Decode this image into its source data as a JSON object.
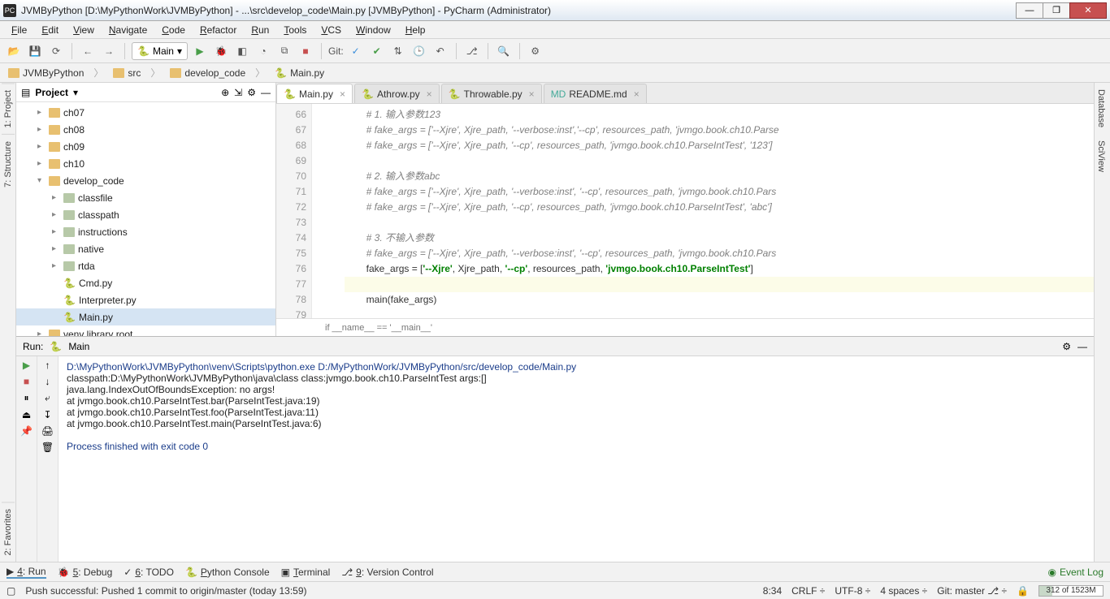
{
  "title": "JVMByPython [D:\\MyPythonWork\\JVMByPython] - ...\\src\\develop_code\\Main.py [JVMByPython] - PyCharm (Administrator)",
  "menu": [
    "File",
    "Edit",
    "View",
    "Navigate",
    "Code",
    "Refactor",
    "Run",
    "Tools",
    "VCS",
    "Window",
    "Help"
  ],
  "runConfig": "Main",
  "gitLabel": "Git:",
  "breadcrumbs": [
    "JVMByPython",
    "src",
    "develop_code",
    "Main.py"
  ],
  "leftTabs": [
    "1: Project",
    "7: Structure"
  ],
  "rightTabs": [
    "Database",
    "SciView"
  ],
  "bottomLeftTab": "2: Favorites",
  "project": {
    "header": "Project",
    "nodes": [
      {
        "indent": 1,
        "arrow": "▸",
        "type": "folder",
        "label": "ch07"
      },
      {
        "indent": 1,
        "arrow": "▸",
        "type": "folder",
        "label": "ch08"
      },
      {
        "indent": 1,
        "arrow": "▸",
        "type": "folder",
        "label": "ch09"
      },
      {
        "indent": 1,
        "arrow": "▸",
        "type": "folder",
        "label": "ch10"
      },
      {
        "indent": 1,
        "arrow": "▾",
        "type": "folder",
        "label": "develop_code"
      },
      {
        "indent": 2,
        "arrow": "▸",
        "type": "dir",
        "label": "classfile"
      },
      {
        "indent": 2,
        "arrow": "▸",
        "type": "dir",
        "label": "classpath"
      },
      {
        "indent": 2,
        "arrow": "▸",
        "type": "dir",
        "label": "instructions"
      },
      {
        "indent": 2,
        "arrow": "▸",
        "type": "dir",
        "label": "native"
      },
      {
        "indent": 2,
        "arrow": "▸",
        "type": "dir",
        "label": "rtda"
      },
      {
        "indent": 2,
        "arrow": "",
        "type": "py",
        "label": "Cmd.py"
      },
      {
        "indent": 2,
        "arrow": "",
        "type": "py",
        "label": "Interpreter.py"
      },
      {
        "indent": 2,
        "arrow": "",
        "type": "py",
        "label": "Main.py",
        "sel": true
      },
      {
        "indent": 1,
        "arrow": "▸",
        "type": "folder",
        "label": "venv library root"
      }
    ]
  },
  "tabs": [
    {
      "label": "Main.py",
      "icon": "py",
      "active": true
    },
    {
      "label": "Athrow.py",
      "icon": "py"
    },
    {
      "label": "Throwable.py",
      "icon": "py"
    },
    {
      "label": "README.md",
      "icon": "md"
    }
  ],
  "code": {
    "startLine": 66,
    "lines": [
      {
        "n": 66,
        "html": "        <span class='c'># 1. 输入参数123</span>"
      },
      {
        "n": 67,
        "html": "        <span class='c'># fake_args = ['--Xjre', Xjre_path, '--verbose:inst','--cp', resources_path, 'jvmgo.book.ch10.Parse</span>"
      },
      {
        "n": 68,
        "html": "        <span class='c'># fake_args = ['--Xjre', Xjre_path, '--cp', resources_path, 'jvmgo.book.ch10.ParseIntTest', '123']</span>"
      },
      {
        "n": 69,
        "html": ""
      },
      {
        "n": 70,
        "html": "        <span class='c'># 2. 输入参数abc</span>"
      },
      {
        "n": 71,
        "html": "        <span class='c'># fake_args = ['--Xjre', Xjre_path, '--verbose:inst', '--cp', resources_path, 'jvmgo.book.ch10.Pars</span>"
      },
      {
        "n": 72,
        "html": "        <span class='c'># fake_args = ['--Xjre', Xjre_path, '--cp', resources_path, 'jvmgo.book.ch10.ParseIntTest', 'abc']</span>"
      },
      {
        "n": 73,
        "html": ""
      },
      {
        "n": 74,
        "html": "        <span class='c'># 3. 不输入参数</span>"
      },
      {
        "n": 75,
        "html": "        <span class='c'># fake_args = ['--Xjre', Xjre_path, '--verbose:inst', '--cp', resources_path, 'jvmgo.book.ch10.Pars</span>"
      },
      {
        "n": 76,
        "html": "        fake_args = [<span class='s'>'--Xjre'</span>, Xjre_path, <span class='s'>'--cp'</span>, resources_path, <span class='s'>'jvmgo.book.ch10.ParseIntTest'</span>]"
      },
      {
        "n": 77,
        "html": "",
        "hl": true
      },
      {
        "n": 78,
        "html": "        main(fake_args)"
      },
      {
        "n": 79,
        "html": ""
      }
    ],
    "breadcrumb": "if __name__ == '__main__'"
  },
  "run": {
    "label": "Run:",
    "config": "Main",
    "lines": [
      {
        "cls": "cmd",
        "text": "D:\\MyPythonWork\\JVMByPython\\venv\\Scripts\\python.exe D:/MyPythonWork/JVMByPython/src/develop_code/Main.py"
      },
      {
        "cls": "",
        "text": "classpath:D:\\MyPythonWork\\JVMByPython\\java\\class class:jvmgo.book.ch10.ParseIntTest args:[]"
      },
      {
        "cls": "",
        "text": "java.lang.IndexOutOfBoundsException: no args!"
      },
      {
        "cls": "",
        "text": "    at jvmgo.book.ch10.ParseIntTest.bar(ParseIntTest.java:19)"
      },
      {
        "cls": "",
        "text": "    at jvmgo.book.ch10.ParseIntTest.foo(ParseIntTest.java:11)"
      },
      {
        "cls": "",
        "text": "    at jvmgo.book.ch10.ParseIntTest.main(ParseIntTest.java:6)"
      },
      {
        "cls": "",
        "text": ""
      },
      {
        "cls": "exit",
        "text": "Process finished with exit code 0"
      }
    ]
  },
  "bottomTabs": [
    {
      "label": "4: Run",
      "icon": "▶",
      "active": true
    },
    {
      "label": "5: Debug",
      "icon": "🐞"
    },
    {
      "label": "6: TODO",
      "icon": "✓"
    },
    {
      "label": "Python Console",
      "icon": "🐍"
    },
    {
      "label": "Terminal",
      "icon": "▣"
    },
    {
      "label": "9: Version Control",
      "icon": "⎇"
    }
  ],
  "eventLog": "Event Log",
  "status": {
    "push": "Push successful: Pushed 1 commit to origin/master (today 13:59)",
    "pos": "8:34",
    "eol": "CRLF",
    "enc": "UTF-8",
    "indent": "4 spaces",
    "git": "Git: master",
    "mem": "312 of 1523M"
  }
}
